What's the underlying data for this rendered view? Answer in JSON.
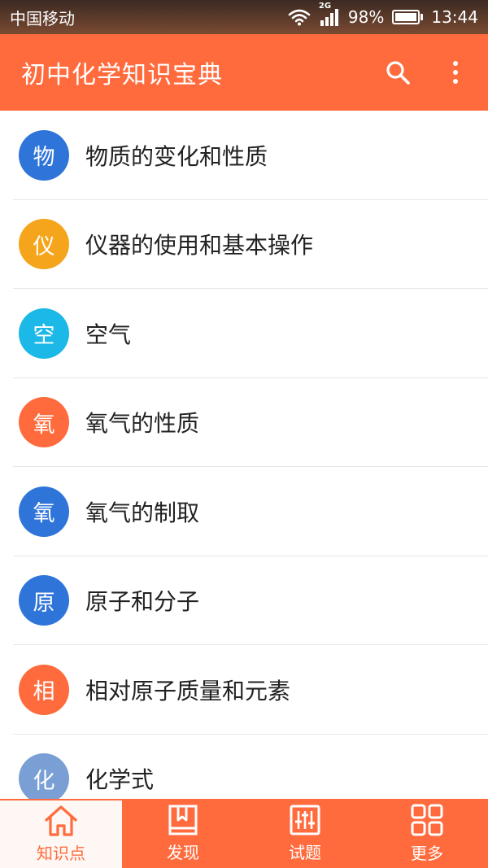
{
  "status_bar": {
    "carrier": "中国移动",
    "network": "2G",
    "battery": "98%",
    "battery_level": 0.98,
    "time": "13:44"
  },
  "app_bar": {
    "title": "初中化学知识宝典",
    "search_icon": "search-icon",
    "more_icon": "more-vert-icon"
  },
  "list": {
    "items": [
      {
        "avatar": "物",
        "label": "物质的变化和性质",
        "color": "#2f74d9"
      },
      {
        "avatar": "仪",
        "label": "仪器的使用和基本操作",
        "color": "#f5a51b"
      },
      {
        "avatar": "空",
        "label": "空气",
        "color": "#1bb8e8"
      },
      {
        "avatar": "氧",
        "label": "氧气的性质",
        "color": "#ff6b3d"
      },
      {
        "avatar": "氧",
        "label": "氧气的制取",
        "color": "#2f74d9"
      },
      {
        "avatar": "原",
        "label": "原子和分子",
        "color": "#2f74d9"
      },
      {
        "avatar": "相",
        "label": "相对原子质量和元素",
        "color": "#ff6b3d"
      },
      {
        "avatar": "化",
        "label": "化学式",
        "color": "#7a9fd4"
      }
    ]
  },
  "bottom_nav": {
    "tabs": [
      {
        "label": "知识点",
        "icon": "home-icon",
        "active": true
      },
      {
        "label": "发现",
        "icon": "book-icon",
        "active": false
      },
      {
        "label": "试题",
        "icon": "sliders-icon",
        "active": false
      },
      {
        "label": "更多",
        "icon": "grid-icon",
        "active": false
      }
    ]
  },
  "colors": {
    "primary": "#ff6b3d",
    "active_tab_bg": "#fff7f4"
  }
}
